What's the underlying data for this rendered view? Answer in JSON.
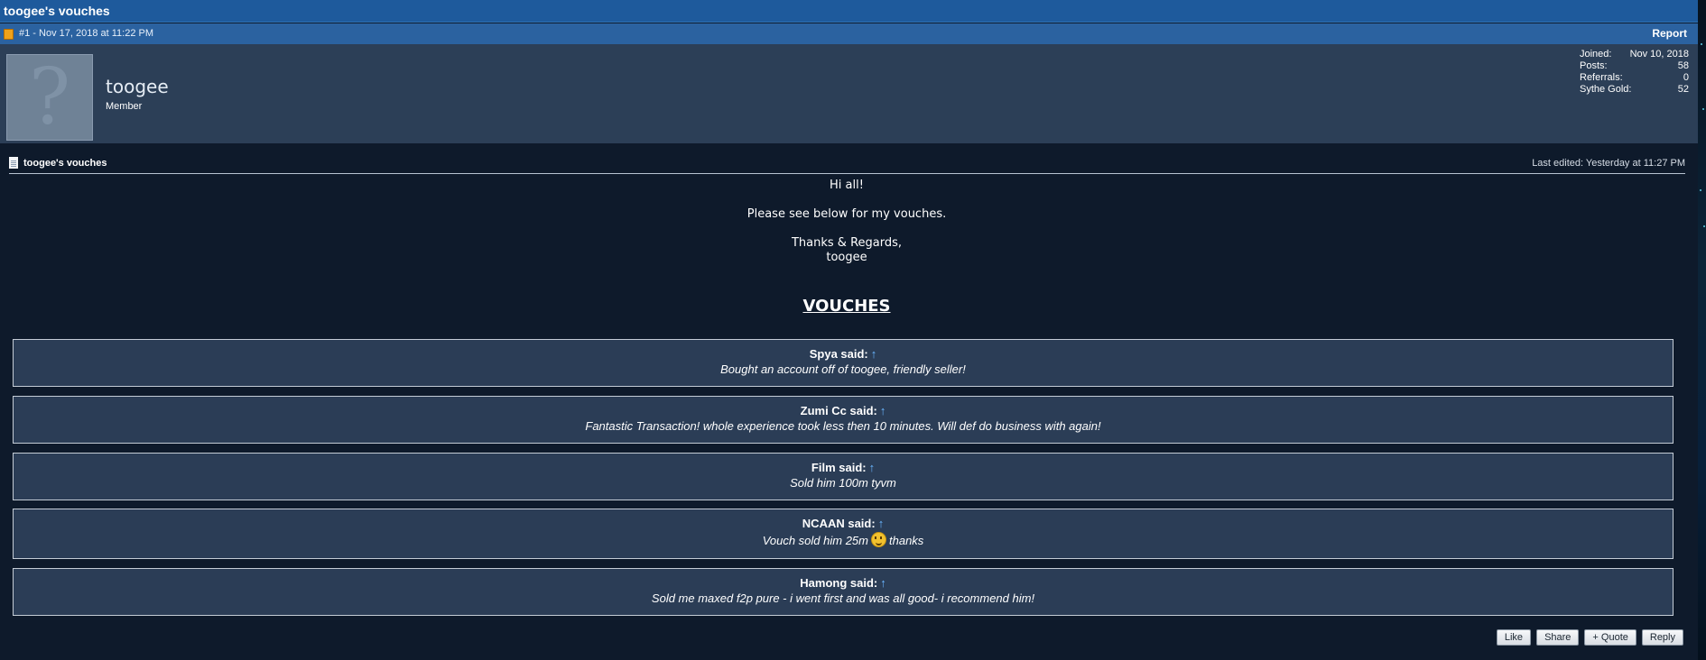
{
  "thread": {
    "title": "toogee's vouches"
  },
  "post": {
    "number_date": "#1 - Nov 17, 2018 at 11:22 PM",
    "report_label": "Report"
  },
  "user": {
    "avatar_glyph": "?",
    "name": "toogee",
    "title": "Member",
    "stats": [
      {
        "label": "Joined:",
        "value": "Nov 10, 2018"
      },
      {
        "label": "Posts:",
        "value": "58"
      },
      {
        "label": "Referrals:",
        "value": "0"
      },
      {
        "label": "Sythe Gold:",
        "value": "52"
      }
    ]
  },
  "message": {
    "title": "toogee's vouches",
    "last_edited": "Last edited: Yesterday at 11:27 PM",
    "lines": [
      "Hi all!",
      "Please see below for my vouches.",
      "Thanks & Regards,",
      "toogee"
    ],
    "vouches_heading": "VOUCHES"
  },
  "vouches": [
    {
      "author": "Spya said:",
      "arrow": "↑",
      "text": "Bought an account off of toogee, friendly seller!"
    },
    {
      "author": "Zumi Cc said:",
      "arrow": "↑",
      "text": "Fantastic Transaction! whole experience took less then 10 minutes. Will def do business with again!"
    },
    {
      "author": "Film said:",
      "arrow": "↑",
      "text": "Sold him 100m tyvm"
    },
    {
      "author": "NCAAN said:",
      "arrow": "↑",
      "text_before": "Vouch sold him 25m",
      "text_after": "thanks"
    },
    {
      "author": "Hamong said:",
      "arrow": "↑",
      "text": "Sold me maxed f2p pure - i went first and was all good- i recommend him!"
    }
  ],
  "actions": {
    "like": "Like",
    "share": "Share",
    "quote": "+ Quote",
    "reply": "Reply"
  },
  "colors": {
    "header": "#1e5a9c",
    "user_block": "#2c3f57",
    "background": "#0e1a2b",
    "vouch_box": "#2b3d56"
  }
}
